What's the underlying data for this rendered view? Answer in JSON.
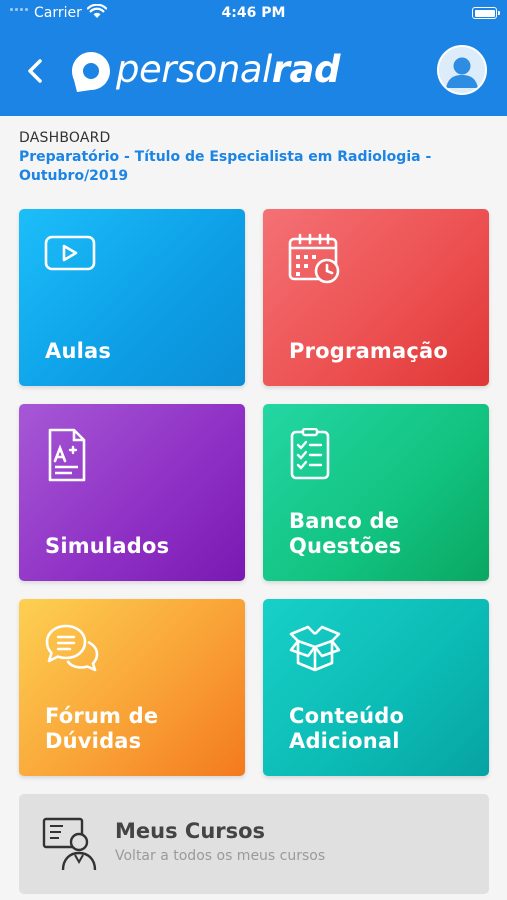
{
  "status_bar": {
    "carrier": "Carrier",
    "time": "4:46 PM"
  },
  "header": {
    "logo_part1": "personal",
    "logo_part2": "rad",
    "brand_color": "#1b84e4",
    "back_icon": "chevron-left-icon",
    "profile_icon": "user-avatar-icon"
  },
  "breadcrumb": {
    "section": "DASHBOARD",
    "course": "Preparatório - Título de Especialista em Radiologia - Outubro/2019"
  },
  "tiles": [
    {
      "label": "Aulas",
      "icon": "video-play-icon",
      "color": "#1cb0f2"
    },
    {
      "label": "Programação",
      "icon": "calendar-clock-icon",
      "color": "#ec4f4f"
    },
    {
      "label": "Simulados",
      "icon": "exam-grade-icon",
      "color": "#8e2fc4"
    },
    {
      "label": "Banco de Questões",
      "icon": "checklist-icon",
      "color": "#11c27f"
    },
    {
      "label": "Fórum de Dúvidas",
      "icon": "chat-bubbles-icon",
      "color": "#f9a337"
    },
    {
      "label": "Conteúdo Adicional",
      "icon": "open-box-icon",
      "color": "#0bbab4"
    }
  ],
  "my_courses": {
    "title": "Meus Cursos",
    "subtitle": "Voltar a todos os meus cursos",
    "icon": "online-teacher-icon"
  }
}
